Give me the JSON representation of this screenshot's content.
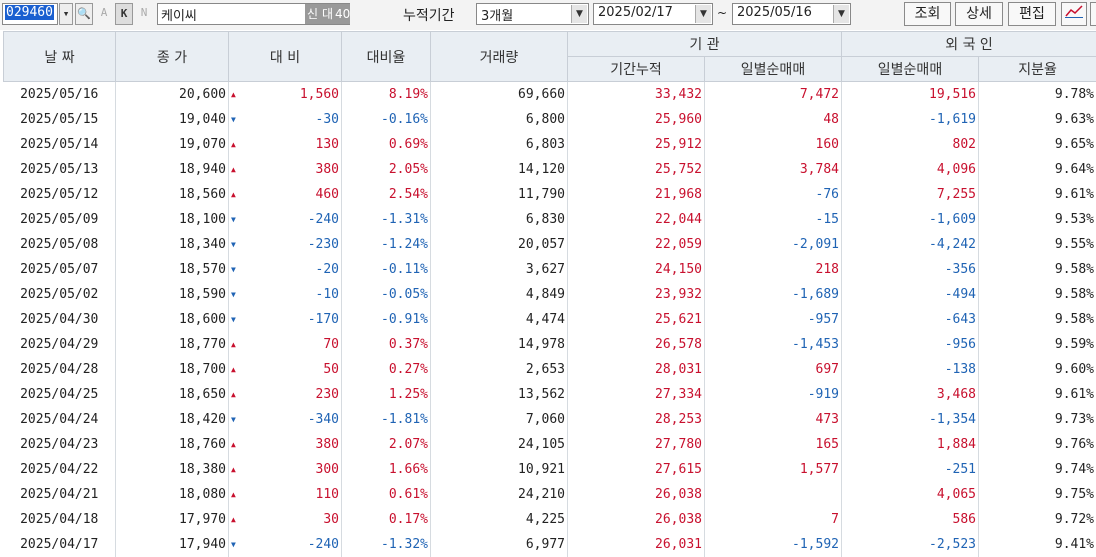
{
  "toolbar": {
    "code": "029460",
    "btn_a": "A",
    "btn_k": "K",
    "btn_n": "N",
    "name": "케이씨",
    "tag_new": "신",
    "tag_credit": "대",
    "tag_40": "40",
    "period_label": "누적기간",
    "period_value": "3개월",
    "date_from": "2025/02/17",
    "tilde": "~",
    "date_to": "2025/05/16",
    "btn_search": "조회",
    "btn_detail": "상세",
    "btn_edit": "편집"
  },
  "headers": {
    "date": "날 짜",
    "close": "종 가",
    "change": "대 비",
    "rate": "대비율",
    "volume": "거래량",
    "institution": "기 관",
    "inst_cum": "기간누적",
    "inst_daily": "일별순매매",
    "foreign": "외 국 인",
    "for_daily": "일별순매매",
    "for_share": "지분율"
  },
  "rows": [
    {
      "date": "2025/05/16",
      "close": "20,600",
      "dir": "up",
      "change": "1,560",
      "rate": "8.19%",
      "volume": "69,660",
      "inst_cum": "33,432",
      "inst_daily": "7,472",
      "for_daily": "19,516",
      "share": "9.78%"
    },
    {
      "date": "2025/05/15",
      "close": "19,040",
      "dir": "down",
      "change": "-30",
      "rate": "-0.16%",
      "volume": "6,800",
      "inst_cum": "25,960",
      "inst_daily": "48",
      "for_daily": "-1,619",
      "share": "9.63%"
    },
    {
      "date": "2025/05/14",
      "close": "19,070",
      "dir": "up",
      "change": "130",
      "rate": "0.69%",
      "volume": "6,803",
      "inst_cum": "25,912",
      "inst_daily": "160",
      "for_daily": "802",
      "share": "9.65%"
    },
    {
      "date": "2025/05/13",
      "close": "18,940",
      "dir": "up",
      "change": "380",
      "rate": "2.05%",
      "volume": "14,120",
      "inst_cum": "25,752",
      "inst_daily": "3,784",
      "for_daily": "4,096",
      "share": "9.64%"
    },
    {
      "date": "2025/05/12",
      "close": "18,560",
      "dir": "up",
      "change": "460",
      "rate": "2.54%",
      "volume": "11,790",
      "inst_cum": "21,968",
      "inst_daily": "-76",
      "for_daily": "7,255",
      "share": "9.61%"
    },
    {
      "date": "2025/05/09",
      "close": "18,100",
      "dir": "down",
      "change": "-240",
      "rate": "-1.31%",
      "volume": "6,830",
      "inst_cum": "22,044",
      "inst_daily": "-15",
      "for_daily": "-1,609",
      "share": "9.53%"
    },
    {
      "date": "2025/05/08",
      "close": "18,340",
      "dir": "down",
      "change": "-230",
      "rate": "-1.24%",
      "volume": "20,057",
      "inst_cum": "22,059",
      "inst_daily": "-2,091",
      "for_daily": "-4,242",
      "share": "9.55%"
    },
    {
      "date": "2025/05/07",
      "close": "18,570",
      "dir": "down",
      "change": "-20",
      "rate": "-0.11%",
      "volume": "3,627",
      "inst_cum": "24,150",
      "inst_daily": "218",
      "for_daily": "-356",
      "share": "9.58%"
    },
    {
      "date": "2025/05/02",
      "close": "18,590",
      "dir": "down",
      "change": "-10",
      "rate": "-0.05%",
      "volume": "4,849",
      "inst_cum": "23,932",
      "inst_daily": "-1,689",
      "for_daily": "-494",
      "share": "9.58%"
    },
    {
      "date": "2025/04/30",
      "close": "18,600",
      "dir": "down",
      "change": "-170",
      "rate": "-0.91%",
      "volume": "4,474",
      "inst_cum": "25,621",
      "inst_daily": "-957",
      "for_daily": "-643",
      "share": "9.58%"
    },
    {
      "date": "2025/04/29",
      "close": "18,770",
      "dir": "up",
      "change": "70",
      "rate": "0.37%",
      "volume": "14,978",
      "inst_cum": "26,578",
      "inst_daily": "-1,453",
      "for_daily": "-956",
      "share": "9.59%"
    },
    {
      "date": "2025/04/28",
      "close": "18,700",
      "dir": "up",
      "change": "50",
      "rate": "0.27%",
      "volume": "2,653",
      "inst_cum": "28,031",
      "inst_daily": "697",
      "for_daily": "-138",
      "share": "9.60%"
    },
    {
      "date": "2025/04/25",
      "close": "18,650",
      "dir": "up",
      "change": "230",
      "rate": "1.25%",
      "volume": "13,562",
      "inst_cum": "27,334",
      "inst_daily": "-919",
      "for_daily": "3,468",
      "share": "9.61%"
    },
    {
      "date": "2025/04/24",
      "close": "18,420",
      "dir": "down",
      "change": "-340",
      "rate": "-1.81%",
      "volume": "7,060",
      "inst_cum": "28,253",
      "inst_daily": "473",
      "for_daily": "-1,354",
      "share": "9.73%"
    },
    {
      "date": "2025/04/23",
      "close": "18,760",
      "dir": "up",
      "change": "380",
      "rate": "2.07%",
      "volume": "24,105",
      "inst_cum": "27,780",
      "inst_daily": "165",
      "for_daily": "1,884",
      "share": "9.76%"
    },
    {
      "date": "2025/04/22",
      "close": "18,380",
      "dir": "up",
      "change": "300",
      "rate": "1.66%",
      "volume": "10,921",
      "inst_cum": "27,615",
      "inst_daily": "1,577",
      "for_daily": "-251",
      "share": "9.74%"
    },
    {
      "date": "2025/04/21",
      "close": "18,080",
      "dir": "up",
      "change": "110",
      "rate": "0.61%",
      "volume": "24,210",
      "inst_cum": "26,038",
      "inst_daily": "",
      "for_daily": "4,065",
      "share": "9.75%"
    },
    {
      "date": "2025/04/18",
      "close": "17,970",
      "dir": "up",
      "change": "30",
      "rate": "0.17%",
      "volume": "4,225",
      "inst_cum": "26,038",
      "inst_daily": "7",
      "for_daily": "586",
      "share": "9.72%"
    },
    {
      "date": "2025/04/17",
      "close": "17,940",
      "dir": "down",
      "change": "-240",
      "rate": "-1.32%",
      "volume": "6,977",
      "inst_cum": "26,031",
      "inst_daily": "-1,592",
      "for_daily": "-2,523",
      "share": "9.41%"
    }
  ],
  "colors": {
    "up": "#c8102e",
    "down": "#1f63b4",
    "header_bg": "#e9eef3"
  }
}
